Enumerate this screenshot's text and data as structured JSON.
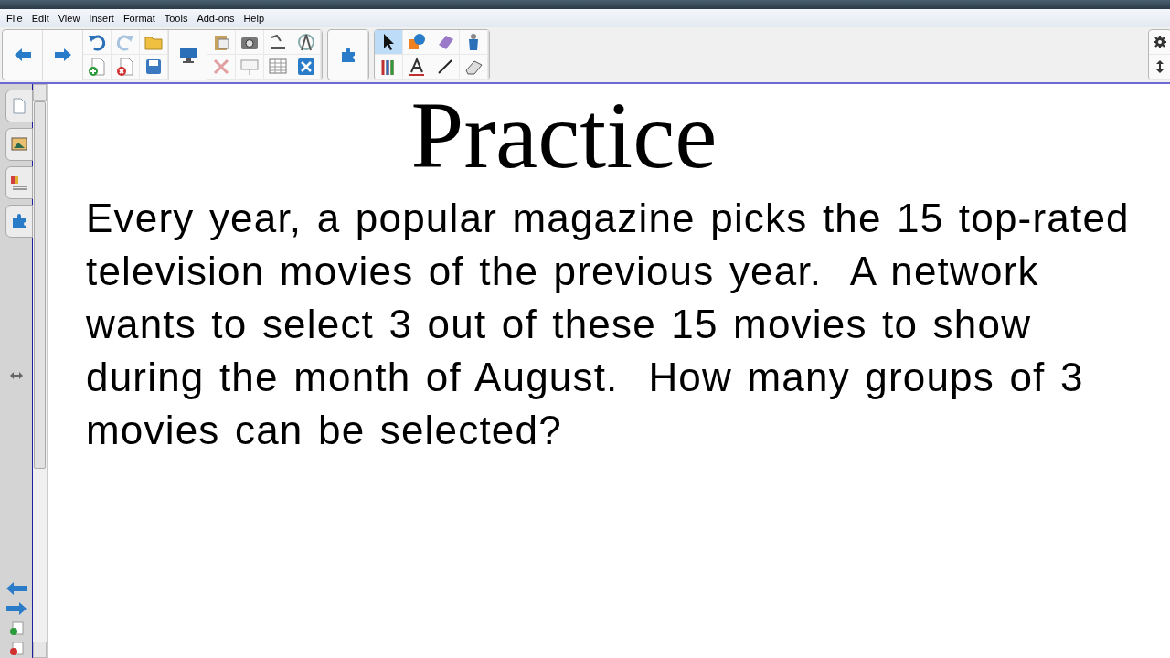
{
  "menu": [
    "File",
    "Edit",
    "View",
    "Insert",
    "Format",
    "Tools",
    "Add-ons",
    "Help"
  ],
  "page": {
    "title": "Practice",
    "body": "Every year, a popular magazine picks the 15 top-rated television movies of the previous year.  A network wants to select 3 out of these 15 movies to show during the month of August.  How many groups of 3 movies can be selected?"
  }
}
